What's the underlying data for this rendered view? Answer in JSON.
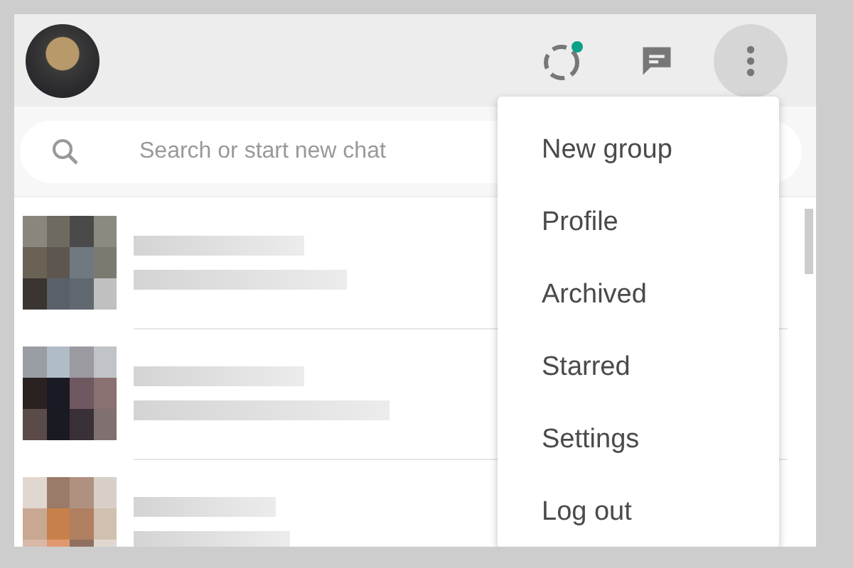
{
  "search": {
    "placeholder": "Search or start new chat"
  },
  "menu": {
    "open": true,
    "items": [
      {
        "label": "New group"
      },
      {
        "label": "Profile"
      },
      {
        "label": "Archived"
      },
      {
        "label": "Starred"
      },
      {
        "label": "Settings"
      },
      {
        "label": "Log out"
      }
    ]
  }
}
